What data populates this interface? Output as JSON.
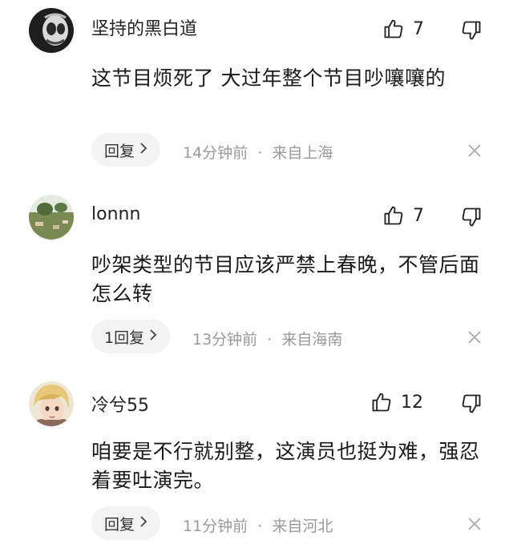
{
  "comments": [
    {
      "username": "坚持的黑白道",
      "likes": "7",
      "text": "这节目烦死了 大过年整个节目吵嚷嚷的",
      "reply_label": "回复",
      "time": "14分钟前",
      "location": "来自上海"
    },
    {
      "username": "lonnn",
      "likes": "7",
      "text": "吵架类型的节目应该严禁上春晚，不管后面怎么转",
      "reply_label": "1回复",
      "time": "13分钟前",
      "location": "来自海南"
    },
    {
      "username": "冷兮55",
      "likes": "12",
      "text": "咱要是不行就别整，这演员也挺为难，强忍着要吐演完。",
      "reply_label": "回复",
      "time": "11分钟前",
      "location": "来自河北"
    }
  ],
  "meta_separator": "·",
  "icons": {
    "like": "thumbs-up-icon",
    "dislike": "thumbs-down-icon",
    "close": "close-icon",
    "chevron": "chevron-right-icon"
  },
  "colors": {
    "background": "#ffffff",
    "text": "#1a1a1a",
    "meta": "#9a9a9a",
    "reply_bg": "#f3f3f3"
  }
}
